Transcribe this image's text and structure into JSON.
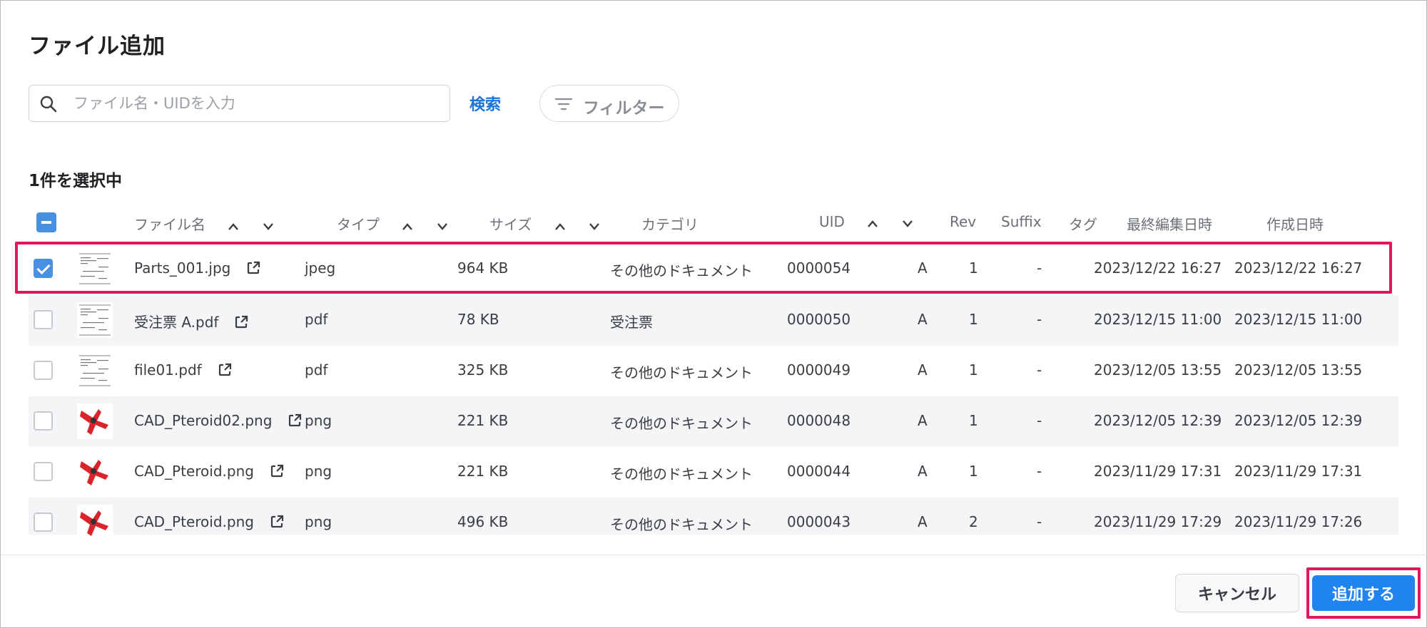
{
  "dialog": {
    "title": "ファイル追加",
    "search": {
      "placeholder": "ファイル名・UIDを入力",
      "value": "",
      "button_label": "検索"
    },
    "filter_label": "フィルター",
    "selected_count_text": "1件を選択中"
  },
  "table": {
    "columns": {
      "name": "ファイル名",
      "type": "タイプ",
      "size": "サイズ",
      "category": "カテゴリ",
      "uid": "UID",
      "rev": "Rev",
      "suffix": "Suffix",
      "tag": "タグ",
      "modified": "最終編集日時",
      "created": "作成日時"
    },
    "rows": [
      {
        "selected": true,
        "thumb": "doc-icon",
        "name": "Parts_001.jpg",
        "type": "jpeg",
        "size": "964 KB",
        "category": "その他のドキュメント",
        "uid": "0000054",
        "rev": "A",
        "suffix": "1",
        "tag": "-",
        "modified": "2023/12/22 16:27",
        "created": "2023/12/22 16:27"
      },
      {
        "selected": false,
        "thumb": "doc-icon",
        "name": "受注票 A.pdf",
        "type": "pdf",
        "size": "78 KB",
        "category": "受注票",
        "uid": "0000050",
        "rev": "A",
        "suffix": "1",
        "tag": "-",
        "modified": "2023/12/15 11:00",
        "created": "2023/12/15 11:00"
      },
      {
        "selected": false,
        "thumb": "doc-icon",
        "name": "file01.pdf",
        "type": "pdf",
        "size": "325 KB",
        "category": "その他のドキュメント",
        "uid": "0000049",
        "rev": "A",
        "suffix": "1",
        "tag": "-",
        "modified": "2023/12/05 13:55",
        "created": "2023/12/05 13:55"
      },
      {
        "selected": false,
        "thumb": "cad-icon",
        "name": "CAD_Pteroid02.png",
        "type": "png",
        "size": "221 KB",
        "category": "その他のドキュメント",
        "uid": "0000048",
        "rev": "A",
        "suffix": "1",
        "tag": "-",
        "modified": "2023/12/05 12:39",
        "created": "2023/12/05 12:39"
      },
      {
        "selected": false,
        "thumb": "cad-icon",
        "name": "CAD_Pteroid.png",
        "type": "png",
        "size": "221 KB",
        "category": "その他のドキュメント",
        "uid": "0000044",
        "rev": "A",
        "suffix": "1",
        "tag": "-",
        "modified": "2023/11/29 17:31",
        "created": "2023/11/29 17:31"
      },
      {
        "selected": false,
        "thumb": "cad-icon",
        "name": "CAD_Pteroid.png",
        "type": "png",
        "size": "496 KB",
        "category": "その他のドキュメント",
        "uid": "0000043",
        "rev": "A",
        "suffix": "2",
        "tag": "-",
        "modified": "2023/11/29 17:29",
        "created": "2023/11/29 17:26"
      }
    ]
  },
  "footer": {
    "cancel_label": "キャンセル",
    "add_label": "追加する"
  },
  "colors": {
    "accent": "#1f84f0",
    "highlight": "#e0175f",
    "checkbox": "#4a90e2",
    "link": "#1a73d9"
  }
}
